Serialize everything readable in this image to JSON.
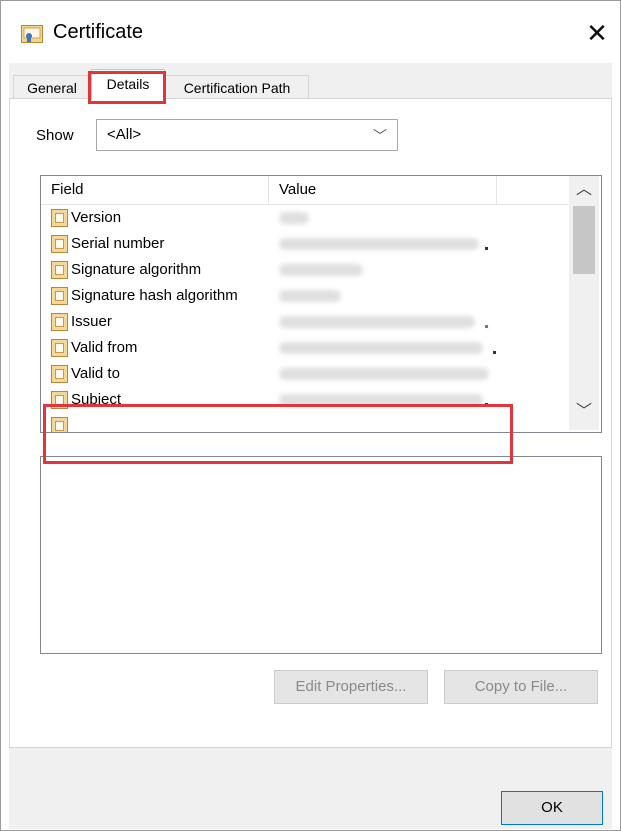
{
  "window": {
    "title": "Certificate",
    "title_icon": "certificate-icon",
    "close_glyph": "✕"
  },
  "tabs": [
    {
      "label": "General",
      "active": false
    },
    {
      "label": "Details",
      "active": true
    },
    {
      "label": "Certification Path",
      "active": false
    }
  ],
  "show": {
    "label": "Show",
    "value": "<All>"
  },
  "fields": {
    "headers": {
      "field": "Field",
      "value": "Value"
    },
    "rows": [
      {
        "field": "Version",
        "value_blurred": true
      },
      {
        "field": "Serial number",
        "value_blurred": true
      },
      {
        "field": "Signature algorithm",
        "value_blurred": true
      },
      {
        "field": "Signature hash algorithm",
        "value_blurred": true
      },
      {
        "field": "Issuer",
        "value_blurred": true
      },
      {
        "field": "Valid from",
        "value_blurred": true
      },
      {
        "field": "Valid to",
        "value_blurred": true
      },
      {
        "field": "Subject",
        "value_blurred": true
      }
    ]
  },
  "buttons": {
    "edit_properties": "Edit Properties...",
    "copy_to_file": "Copy to File...",
    "ok": "OK"
  },
  "annotations": {
    "highlight_color": "#e0363b"
  }
}
